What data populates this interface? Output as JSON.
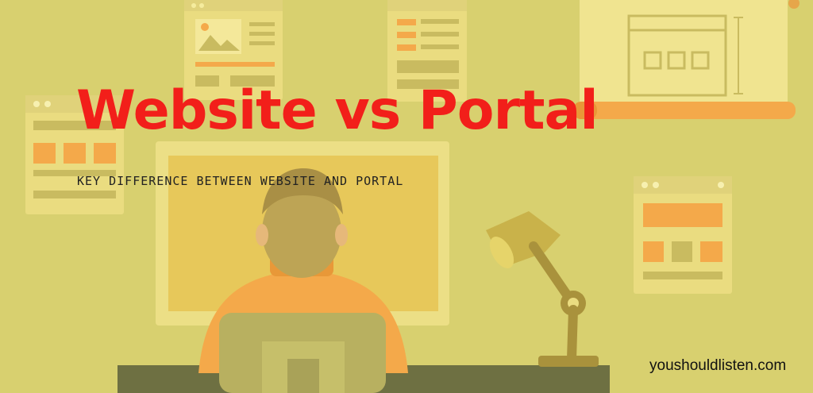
{
  "banner": {
    "title": "Website vs Portal",
    "subtitle": "KEY DIFFERENCE BETWEEN WEBSITE AND PORTAL",
    "site": "youshouldlisten.com"
  }
}
